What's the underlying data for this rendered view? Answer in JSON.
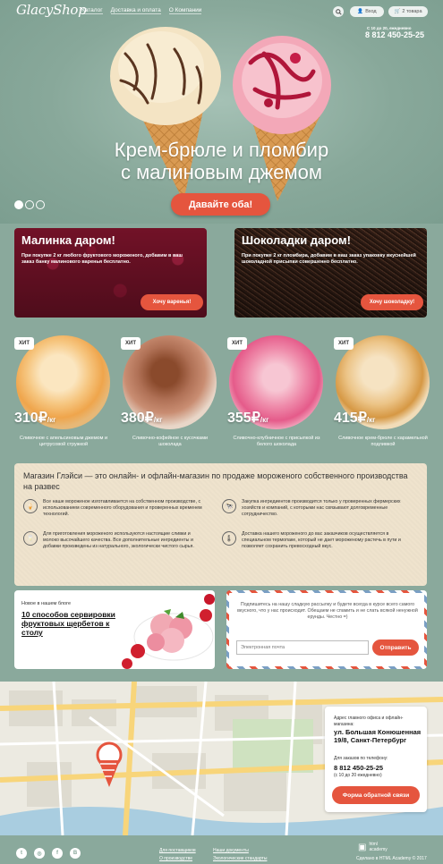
{
  "header": {
    "logo": "GlacyShop",
    "nav": [
      "Каталог",
      "Доставка и оплата",
      "О Компании"
    ],
    "login_label": "Вход",
    "cart_label": "2 товара",
    "hours": "С 10 до 20, ежедневно",
    "phone": "8 812 450-25-25"
  },
  "hero": {
    "title_line1": "Крем-брюле и пломбир",
    "title_line2": "с малиновым джемом",
    "cta": "Давайте оба!",
    "slides": 3,
    "active_slide": 1
  },
  "promos": [
    {
      "title": "Малинка даром!",
      "text": "При покупке 2 кг любого фруктового мороженого, добавим в ваш заказ банку малинового варенья бесплатно.",
      "button": "Хочу варенья!"
    },
    {
      "title": "Шоколадки даром!",
      "text": "При покупке 2 кг пломбира, добавим в ваш заказ упаковку вкуснейшей шоколадной присыпки совершенно бесплатно.",
      "button": "Хочу шоколадку!"
    }
  ],
  "products": [
    {
      "badge": "ХИТ",
      "price": "310₽",
      "unit": "/кг",
      "name": "Сливочное с апельсиновым джемом и цитрусовой стружкой"
    },
    {
      "badge": "ХИТ",
      "price": "380₽",
      "unit": "/кг",
      "name": "Сливочно-кофейное с кусочками шоколада"
    },
    {
      "badge": "ХИТ",
      "price": "355₽",
      "unit": "/кг",
      "name": "Сливочно-клубничное с присыпкой из белого шоколада"
    },
    {
      "badge": "ХИТ",
      "price": "415₽",
      "unit": "/кг",
      "name": "Сливочное крем-брюле с карамельной подливкой"
    }
  ],
  "info": {
    "title": "Магазин Глэйси — это онлайн- и офлайн-магазин по продаже мороженого собственного производства на развес",
    "features": [
      {
        "icon": "ice-cream-icon",
        "text": "Все наше мороженое изготавливается на собственном производстве, с использованием современного оборудования и проверенных временем технологий."
      },
      {
        "icon": "farm-icon",
        "text": "Закупка ингредиентов производится только у проверенных фермерских хозяйств и компаний, с которыми нас связывают долговременные сотрудничество."
      },
      {
        "icon": "milk-icon",
        "text": "Для приготовления мороженого используются настоящие сливки и молоко высочайшего качества. Все дополнительные ингредиенты и добавки произведены из натурального, экологически чистого сырья."
      },
      {
        "icon": "thermo-icon",
        "text": "Доставка нашего мороженого до вас заказчиков осуществляется в специальном термопаке, который не дает мороженому растечь в пути и позволяет сохранить превосходный вкус."
      }
    ]
  },
  "blog": {
    "kicker": "Новое в нашем блоге",
    "title": "10 способов сервировки фруктовых щербетов к столу"
  },
  "subscribe": {
    "text": "Подпишитесь на нашу сладкую рассылку и будете всегда в курсе всего самого вкусного, что у нас происходит. Обещаем не спамить и не слать всякой ненужной ерунды. Честно =)",
    "placeholder": "Электронная почта",
    "button": "Отправить"
  },
  "contact": {
    "address_label": "Адрес главного офиса и офлайн-магазина:",
    "address": "ул. Большая Конюшенная 19/8, Санкт-Петербург",
    "phone_label": "Для заказов по телефону:",
    "phone": "8 812 450-25-25",
    "hours": "(с 10 до 20 ежедневно)",
    "button": "Форма обратной связи"
  },
  "footer": {
    "social": [
      "twitter-icon",
      "instagram-icon",
      "facebook-icon",
      "vk-icon"
    ],
    "links": [
      "Для поставщиков",
      "Наши документы",
      "О производстве",
      "Экологические стандарты"
    ],
    "academy_line1": "html",
    "academy_line2": "academy",
    "credit": "Сделано в HTML Academy © 2017"
  },
  "colors": {
    "accent": "#e5553e",
    "background": "#8aa99c",
    "info_bg": "#efe3cd"
  }
}
